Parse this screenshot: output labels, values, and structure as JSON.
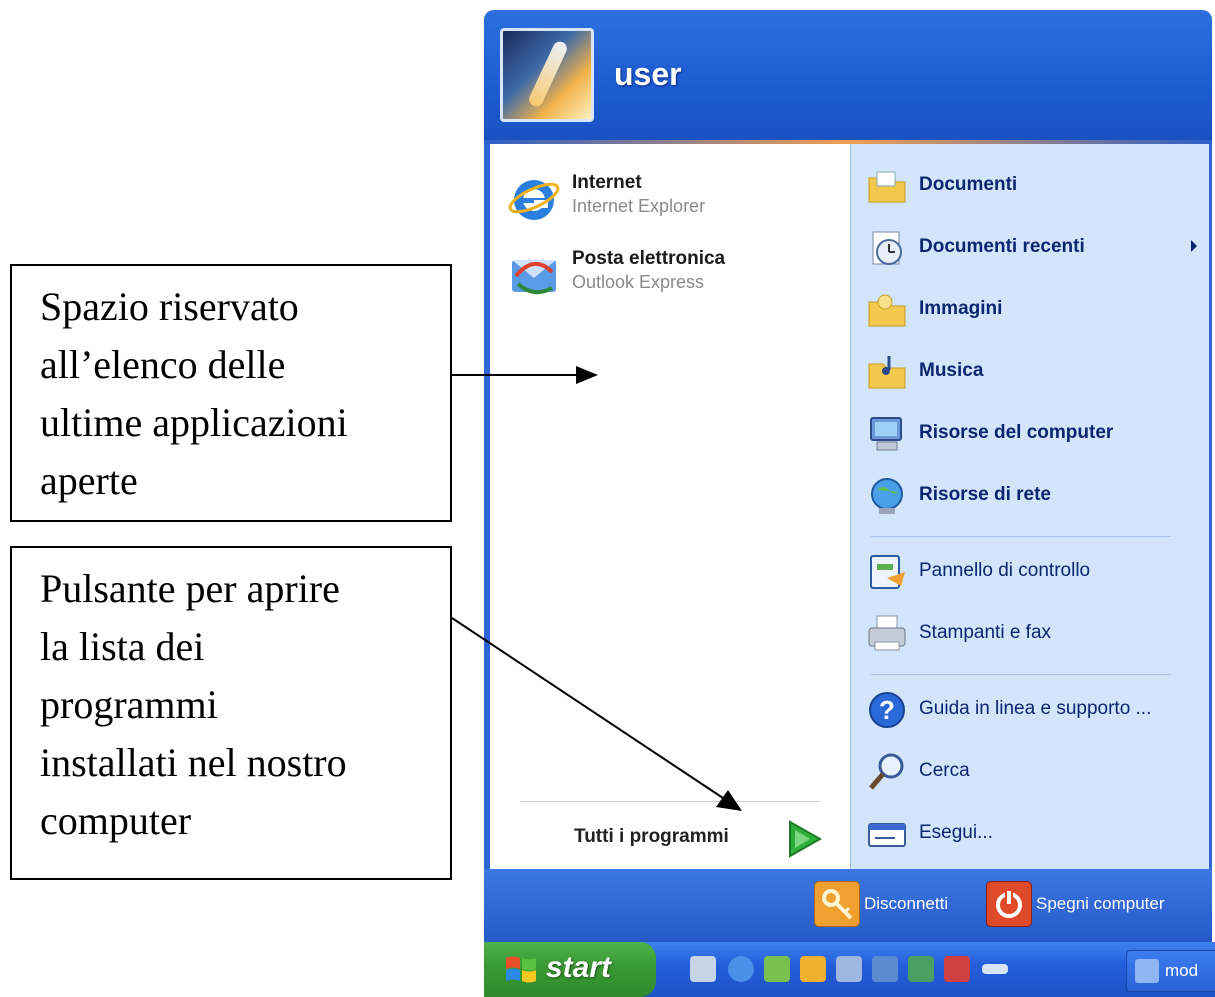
{
  "annotations": [
    {
      "lines": [
        "Spazio riservato",
        "all’elenco delle",
        "ultime applicazioni",
        "aperte"
      ]
    },
    {
      "lines": [
        "Pulsante per aprire",
        "la lista dei",
        "programmi",
        "installati nel nostro",
        "computer"
      ]
    }
  ],
  "start_menu": {
    "user": "user",
    "pinned": [
      {
        "title": "Internet",
        "subtitle": "Internet Explorer",
        "icon": "internet-explorer-icon"
      },
      {
        "title": "Posta elettronica",
        "subtitle": "Outlook Express",
        "icon": "outlook-express-icon"
      }
    ],
    "all_programs": "Tutti i programmi",
    "right_items": [
      {
        "label": "Documenti",
        "icon": "documents-folder-icon"
      },
      {
        "label": "Documenti recenti",
        "icon": "recent-documents-icon"
      },
      {
        "label": "Immagini",
        "icon": "pictures-folder-icon"
      },
      {
        "label": "Musica",
        "icon": "music-folder-icon"
      },
      {
        "label": "Risorse del computer",
        "icon": "my-computer-icon"
      },
      {
        "label": "Risorse di rete",
        "icon": "network-places-icon"
      },
      {
        "label": "Pannello di controllo",
        "icon": "control-panel-icon"
      },
      {
        "label": "Stampanti e fax",
        "icon": "printers-fax-icon"
      },
      {
        "label": "Guida in linea e supporto ...",
        "icon": "help-icon"
      },
      {
        "label": "Cerca",
        "icon": "search-icon"
      },
      {
        "label": "Esegui...",
        "icon": "run-icon"
      }
    ],
    "footer": {
      "logoff": "Disconnetti",
      "shutdown": "Spegni computer"
    }
  },
  "taskbar": {
    "start": "start",
    "task_label": "mod"
  },
  "colors": {
    "header_blue": "#1c5bd0",
    "right_panel": "#d3e5fa",
    "start_green": "#3a9a35",
    "arrow_green": "#2fae3a"
  }
}
